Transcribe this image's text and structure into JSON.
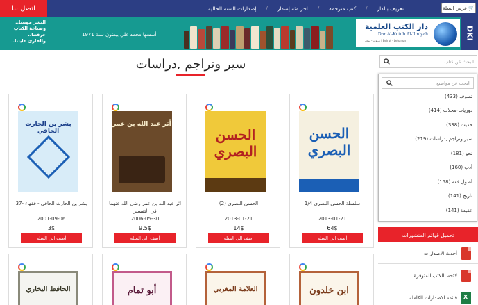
{
  "topnav": {
    "cart_label": "عرض السلة",
    "items": [
      "تعريف بالدار",
      "كتب مترجمة",
      "اخر مئه إصدار",
      "إصدارات السنه الحاليه"
    ],
    "contact_label": "اتصل بنا"
  },
  "banner": {
    "slogan_lines": [
      "النشر مهنتنا..",
      "وصناعة الكتاب حرفتنا..",
      "والقارئ غايتنا.."
    ],
    "founded": "أسسها محمد علي بيضون سنة 1971",
    "logo_name": "دار الكتب العلمية",
    "logo_latin": "Dar Al-Kotob Al-Ilmiyah",
    "logo_city": "Beirut - Lebanon | بيروت - لبنان",
    "dki": "DKI"
  },
  "page_title": "سير وتراجم ,دراسات",
  "search": {
    "placeholder": "البحث عن كتاب"
  },
  "topics": {
    "placeholder": "البحث عن مواضيع",
    "items": [
      "تصوف (433)",
      "دوريات-مجلات (414)",
      "حديث (338)",
      "سير وتراجم ,دراسات (219)",
      "نحو (181)",
      "أدب (160)",
      "أصول فقه (158)",
      "تاريخ (141)",
      "عقيدة (141)"
    ]
  },
  "lists": {
    "header": "تحميل قوائم المنشورات",
    "items": [
      "أحدث الاصدارات",
      "لائحه بالكتب المتوفرة",
      "قائمة الاصدارات الكاملة"
    ]
  },
  "products": [
    {
      "name": "سلسلة الحسن البصري 1/4",
      "date": "2013-01-21",
      "price": "64$",
      "button": "أضف الى السله",
      "cover_title": "الحسن البصري"
    },
    {
      "name": "الحسن البصري (2)",
      "date": "2013-01-21",
      "price": "14$",
      "button": "أضف الى السله",
      "cover_title": "الحسن البصري"
    },
    {
      "name": "اثر عبد الله بن عمر رضي الله عنهما في التفسير",
      "date": "2006-05-30",
      "price": "9.5$",
      "button": "أضف الى السله",
      "cover_title": "أثر عبد الله بن عمر"
    },
    {
      "name": "بشر بن الحارث الحافي - فقهاء -37",
      "date": "2001-09-06",
      "price": "3$",
      "button": "أضف الى السله",
      "cover_title": "بشر بن الحارث الحافي"
    }
  ],
  "products_row2": [
    {
      "cover_title": "ابن خلدون"
    },
    {
      "cover_title": "العلامة المغربي"
    },
    {
      "cover_title": "أبو تمام"
    },
    {
      "cover_title": "الحافظ البخاري"
    }
  ],
  "colors": {
    "nav": "#2c3e84",
    "accent": "#e8232a",
    "banner": "#169a91"
  }
}
